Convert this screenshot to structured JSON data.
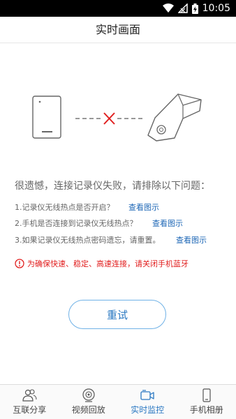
{
  "status_bar": {
    "time": "10:05"
  },
  "header": {
    "title": "实时画面"
  },
  "message": {
    "error_title": "很遗憾，连接记录仪失败，请排除以下问题：",
    "tips": [
      {
        "text": "1.记录仪无线热点是否开启？",
        "link": "查看图示"
      },
      {
        "text": "2.手机是否连接到记录仪无线热点？",
        "link": "查看图示"
      },
      {
        "text": "3.如果记录仪无线热点密码遗忘，请重置。",
        "link": "查看图示"
      }
    ],
    "warning": "为确保快速、稳定、高速连接，请关闭手机蓝牙"
  },
  "retry_button": {
    "label": "重试"
  },
  "bottom_nav": {
    "items": [
      {
        "label": "互联分享",
        "icon": "people-icon",
        "active": false
      },
      {
        "label": "视频回放",
        "icon": "camera-lens-icon",
        "active": false
      },
      {
        "label": "实时监控",
        "icon": "video-camera-icon",
        "active": true
      },
      {
        "label": "手机相册",
        "icon": "phone-icon",
        "active": false
      }
    ]
  },
  "colors": {
    "accent": "#2a78c2",
    "warning": "#e11d1d",
    "error_x": "#e02020"
  }
}
